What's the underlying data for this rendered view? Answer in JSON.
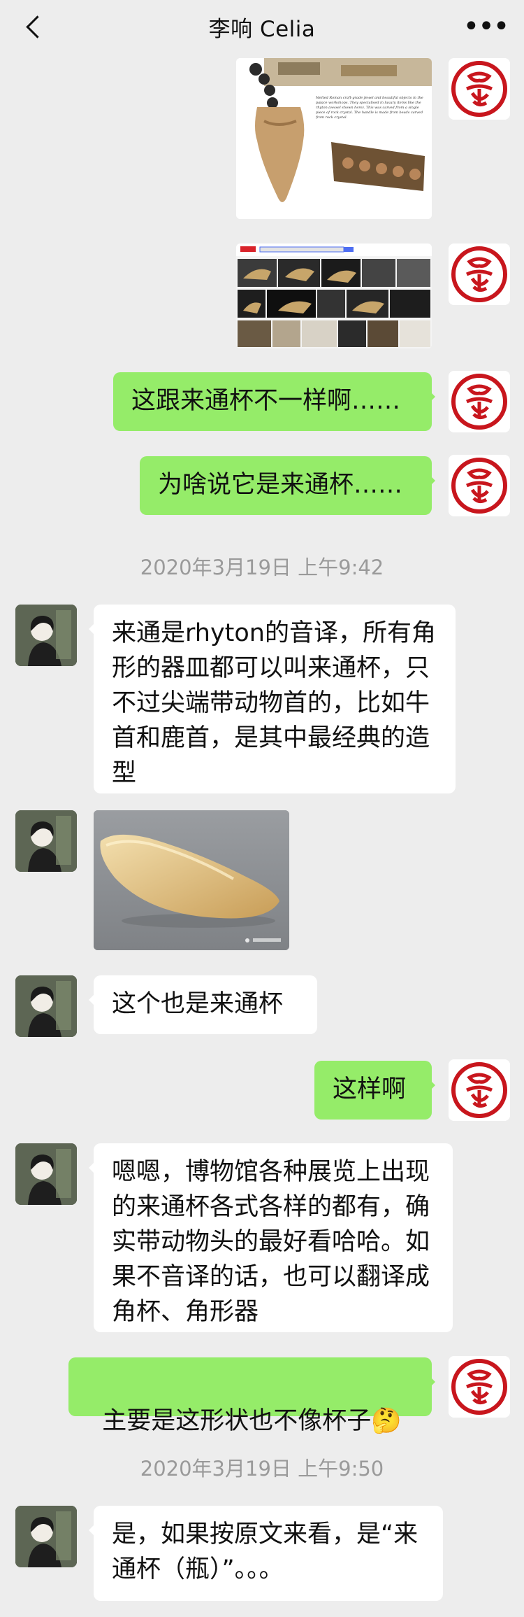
{
  "header": {
    "title": "李响 Celia",
    "back_icon": "chevron-left-icon",
    "more_label": "•••"
  },
  "colors": {
    "background": "#ededed",
    "bubble_self": "#95ec69",
    "bubble_other": "#ffffff",
    "seal_red": "#c8161d"
  },
  "image1": {
    "caption": "Melted Roman craft-grade Jewel and beautiful objects in the palace workshops. They specialised in luxury items like the rhyton (vessel shown here). This was carved from a single piece of rock crystal. The handle is made from beads carved from rock crystal."
  },
  "messages": {
    "m1": "这跟来通杯不一样啊……",
    "m2": "为啥说它是来通杯……",
    "t1": "2020年3月19日 上午9:42",
    "m3": "来通是rhyton的音译，所有角形的器皿都可以叫来通杯，只不过尖端带动物首的，比如牛首和鹿首，是其中最经典的造型",
    "m4": "这个也是来通杯",
    "m5": "这样啊",
    "m6": "嗯嗯，博物馆各种展览上出现的来通杯各式各样的都有，确实带动物头的最好看哈哈。如果不音译的话，也可以翻译成角杯、角形器",
    "m7": "主要是这形状也不像杯子",
    "m7_emoji": "🤔",
    "t2": "2020年3月19日 上午9:50",
    "m8": "是，如果按原文来看，是“来通杯（瓶）”。。。"
  }
}
